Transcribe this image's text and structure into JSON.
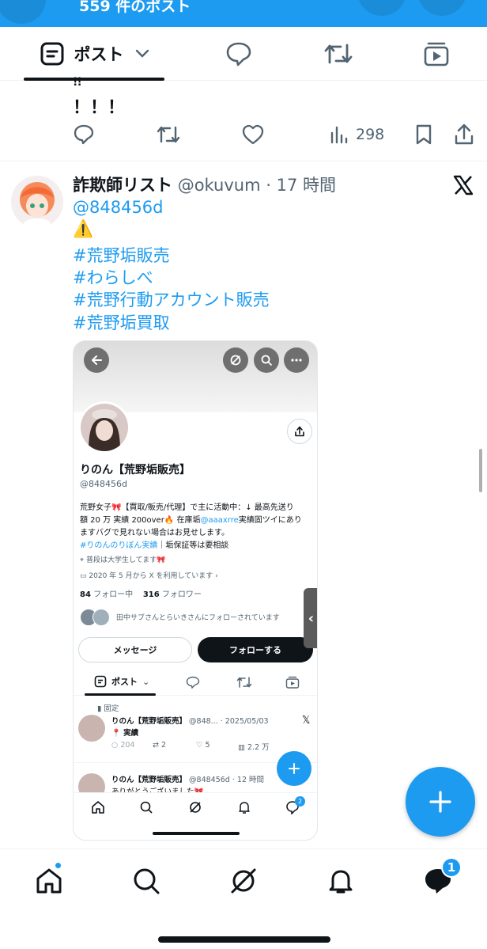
{
  "header": {
    "post_count": "559 件のポスト"
  },
  "tabs": {
    "posts_label": "ポスト"
  },
  "prev_post": {
    "line1": "!!",
    "line2": "！！！",
    "views": "298"
  },
  "post": {
    "display_name": "詐欺師リスト",
    "handle": "@okuvum",
    "time": "· 17 時間",
    "mention": "@848456d",
    "warning": "⚠️",
    "hashtags": [
      "#荒野垢販売",
      "#わらしべ",
      "#荒野行動アカウント販売",
      "#荒野垢買取"
    ]
  },
  "shot": {
    "name": "りのん【荒野垢販売】",
    "handle": "@848456d",
    "bio_line1": "荒野女子🎀【買取/販売/代理】で主に活動中：↓ 最高先送り",
    "bio_line2_a": "額 20 万 実績 200over🔥 在庫垢",
    "bio_line2_link": "@aaaxrre",
    "bio_line2_b": "実績固ツイにあり",
    "bio_line3": "ますバグで見れない場合はお見せします。",
    "bio_line4_link": "#りのんのりぼん実績",
    "bio_line4_b": "｜垢保証等は要相談",
    "location": "普段は大学生してます🎀",
    "joined": "2020 年 5 月から X を利用しています",
    "following_count": "84",
    "following_label": "フォロー中",
    "followers_count": "316",
    "followers_label": "フォロワー",
    "followed_by": "田中サブさんとらいきさんにフォローされています",
    "message_btn": "メッセージ",
    "follow_btn": "フォローする",
    "tab_posts": "ポスト",
    "pinned": "固定",
    "tweet1_name": "りのん【荒野垢販売】",
    "tweet1_meta": "@848... · 2025/05/03",
    "tweet1_text": "📍 実績",
    "tweet1_replies": "204",
    "tweet1_rts": "2",
    "tweet1_likes": "5",
    "tweet1_views": "2.2 万",
    "tweet2_name": "りのん【荒野垢販売】",
    "tweet2_meta": "@848456d · 12 時間",
    "tweet2_text": "ありがとうございました🎀",
    "dm_badge": "2"
  },
  "nav": {
    "messages_badge": "1"
  },
  "colors": {
    "accent": "#1d9bf0",
    "text": "#0f1419",
    "muted": "#536471"
  }
}
